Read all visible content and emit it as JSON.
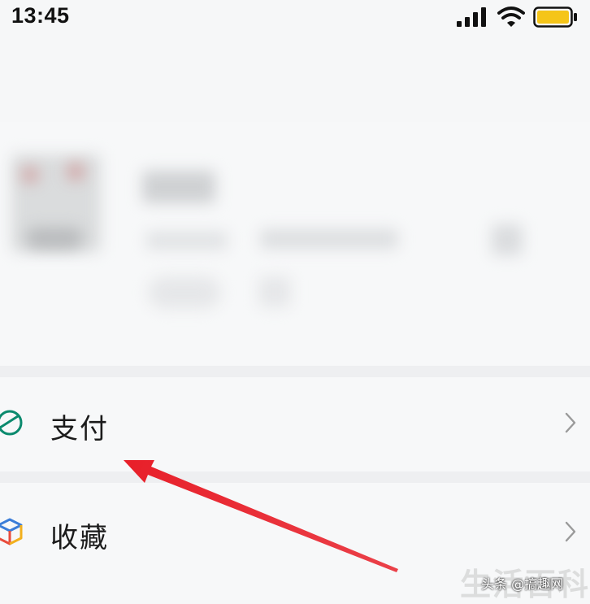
{
  "status_bar": {
    "time": "13:45",
    "icons": [
      "signal-icon",
      "wifi-icon",
      "battery-icon"
    ],
    "battery_color": "#f5c518"
  },
  "menu": {
    "items": [
      {
        "label": "支付",
        "icon": "payment-icon",
        "icon_color": "#0b8a6e"
      },
      {
        "label": "收藏",
        "icon": "favorites-cube-icon"
      }
    ]
  },
  "annotation": {
    "arrow_color": "#e8202a"
  },
  "watermark": {
    "background_text": "生活百科",
    "overlay_text": "头条 @搞趣网"
  }
}
